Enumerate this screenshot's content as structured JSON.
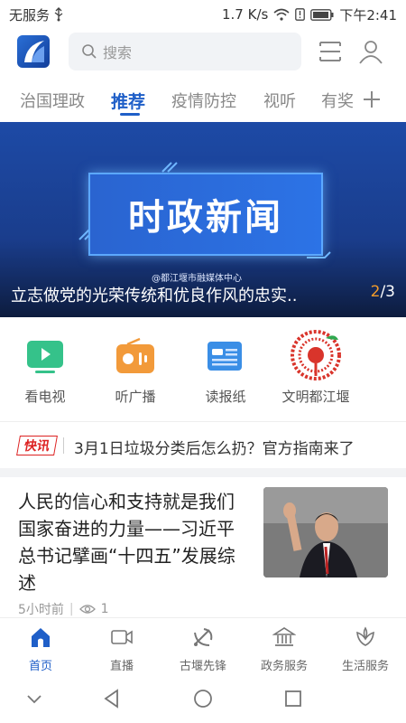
{
  "status_bar": {
    "carrier": "无服务",
    "speed": "1.7 K/s",
    "time": "下午2:41"
  },
  "header": {
    "search_placeholder": "搜索"
  },
  "tabs": [
    {
      "label": "治国理政"
    },
    {
      "label": "推荐"
    },
    {
      "label": "疫情防控"
    },
    {
      "label": "视听"
    },
    {
      "label": "有奖"
    }
  ],
  "banner": {
    "title_text": "时政新闻",
    "source": "@都江堰市融媒体中心",
    "caption": "立志做党的光荣传统和优良作风的忠实..",
    "page_current": "2",
    "page_total": "/3"
  },
  "quick_links": [
    {
      "label": "看电视",
      "icon": "tv-icon",
      "color": "#35c28a"
    },
    {
      "label": "听广播",
      "icon": "radio-icon",
      "color": "#f29a3a"
    },
    {
      "label": "读报纸",
      "icon": "newspaper-icon",
      "color": "#3a8ee6"
    },
    {
      "label": "文明都江堰",
      "icon": "civilization-logo-icon",
      "color": "#d9342b"
    }
  ],
  "news_flash": {
    "badge": "快讯",
    "text": "3月1日垃圾分类后怎么扔？官方指南来了"
  },
  "article": {
    "title": "人民的信心和支持就是我们国家奋进的力量——习近平总书记擘画“十四五”发展综述",
    "time": "5小时前",
    "views": "1"
  },
  "bottom_tabs": [
    {
      "label": "首页",
      "icon": "home-icon"
    },
    {
      "label": "直播",
      "icon": "video-camera-icon"
    },
    {
      "label": "古堰先锋",
      "icon": "party-emblem-icon"
    },
    {
      "label": "政务服务",
      "icon": "government-building-icon"
    },
    {
      "label": "生活服务",
      "icon": "lotus-icon"
    }
  ],
  "colors": {
    "accent": "#1f5fc8",
    "flash_red": "#dd2222",
    "pager_orange": "#f39c2b"
  }
}
